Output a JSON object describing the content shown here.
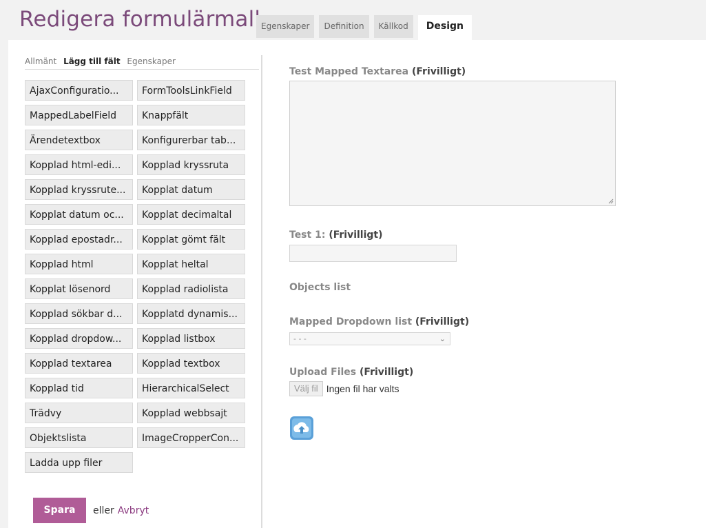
{
  "header": {
    "title": "Redigera formulärmall",
    "tabs": [
      {
        "label": "Egenskaper",
        "active": false
      },
      {
        "label": "Definition",
        "active": false
      },
      {
        "label": "Källkod",
        "active": false
      },
      {
        "label": "Design",
        "active": true
      }
    ]
  },
  "left_panel": {
    "subtabs": [
      {
        "label": "Allmänt",
        "active": false
      },
      {
        "label": "Lägg till fält",
        "active": true
      },
      {
        "label": "Egenskaper",
        "active": false
      }
    ],
    "field_buttons": [
      "AjaxConfiguratio...",
      "FormToolsLinkField",
      "MappedLabelField",
      "Knappfält",
      "Ärendetextbox",
      "Konfigurerbar tab...",
      "Kopplad html-edi...",
      "Kopplad kryssruta",
      "Kopplad kryssrute...",
      "Kopplat datum",
      "Kopplat datum oc...",
      "Kopplat decimaltal",
      "Kopplad epostadr...",
      "Kopplat gömt fält",
      "Kopplad html",
      "Kopplat heltal",
      "Kopplat lösenord",
      "Kopplad radiolista",
      "Kopplad sökbar d...",
      "Kopplatd dynamis...",
      "Kopplad dropdow...",
      "Kopplad listbox",
      "Kopplad textarea",
      "Kopplad textbox",
      "Kopplad tid",
      "HierarchicalSelect",
      "Trädvy",
      "Kopplad webbsajt",
      "Objektslista",
      "ImageCropperCon...",
      "Ladda upp filer"
    ],
    "save_label": "Spara",
    "or_text": "eller",
    "cancel_label": "Avbryt"
  },
  "form": {
    "textarea_label": "Test Mapped Textarea",
    "textarea_optional": "(Frivilligt)",
    "test1_label": "Test 1:",
    "test1_optional": "(Frivilligt)",
    "objects_list_label": "Objects list",
    "dropdown_label": "Mapped Dropdown list",
    "dropdown_optional": "(Frivilligt)",
    "dropdown_value": "- - -",
    "upload_label": "Upload Files",
    "upload_optional": "(Frivilligt)",
    "file_button": "Välj fil",
    "file_status": "Ingen fil har valts",
    "upload_icon": "cloud-upload-icon"
  },
  "colors": {
    "title": "#7b4a7a",
    "save_button": "#b05c97",
    "cancel_link": "#8b3b80",
    "upload_icon": "#4a90c8"
  }
}
